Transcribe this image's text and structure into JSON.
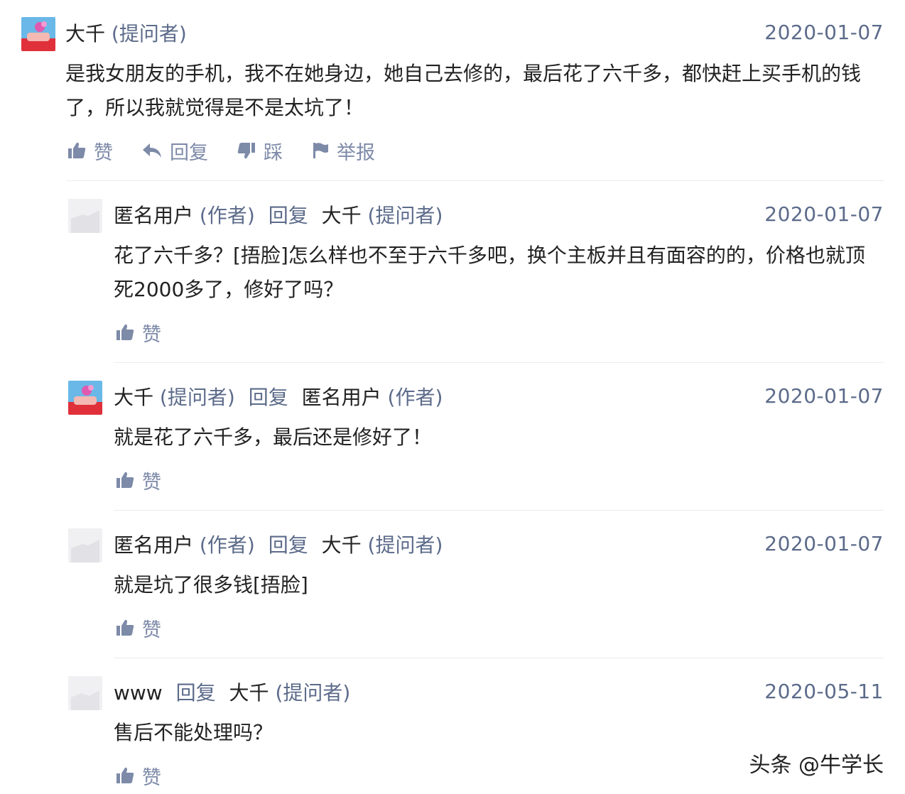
{
  "comments": [
    {
      "author": "大千",
      "author_tag": "(提问者)",
      "date": "2020-01-07",
      "text": "是我女朋友的手机，我不在她身边，她自己去修的，最后花了六千多，都快赶上买手机的钱了，所以我就觉得是不是太坑了！",
      "actions": {
        "like": "赞",
        "reply": "回复",
        "dislike": "踩",
        "report": "举报"
      }
    },
    {
      "author": "匿名用户",
      "author_tag": "(作者)",
      "reply_word": "回复",
      "reply_to": "大千",
      "reply_to_tag": "(提问者)",
      "date": "2020-01-07",
      "text": "花了六千多？[捂脸]怎么样也不至于六千多吧，换个主板并且有面容的的，价格也就顶死2000多了，修好了吗？",
      "like": "赞"
    },
    {
      "author": "大千",
      "author_tag": "(提问者)",
      "reply_word": "回复",
      "reply_to": "匿名用户",
      "reply_to_tag": "(作者)",
      "date": "2020-01-07",
      "text": "就是花了六千多，最后还是修好了！",
      "like": "赞"
    },
    {
      "author": "匿名用户",
      "author_tag": "(作者)",
      "reply_word": "回复",
      "reply_to": "大千",
      "reply_to_tag": "(提问者)",
      "date": "2020-01-07",
      "text": "就是坑了很多钱[捂脸]",
      "like": "赞"
    },
    {
      "author": "www",
      "reply_word": "回复",
      "reply_to": "大千",
      "reply_to_tag": "(提问者)",
      "date": "2020-05-11",
      "text": "售后不能处理吗？",
      "like": "赞"
    }
  ],
  "watermark": "头条 @牛学长",
  "colors": {
    "meta_text": "#5c6b8a",
    "action_text": "#7d8aa8",
    "divider": "#ececf0"
  }
}
